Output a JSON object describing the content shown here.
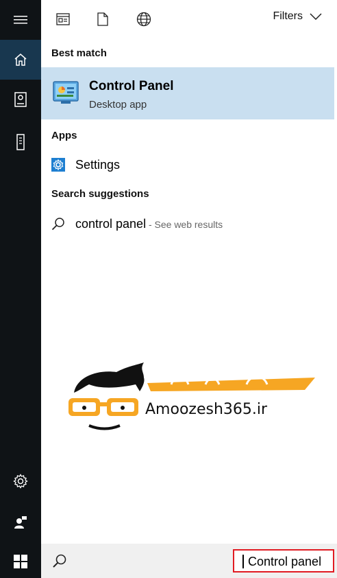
{
  "toolbar": {
    "filters_label": "Filters"
  },
  "results": {
    "best_match_heading": "Best match",
    "best_match": {
      "title": "Control Panel",
      "subtitle": "Desktop app"
    },
    "apps_heading": "Apps",
    "apps": [
      {
        "label": "Settings"
      }
    ],
    "suggestions_heading": "Search suggestions",
    "suggestions": [
      {
        "label": "control panel",
        "suffix": " - See web results"
      }
    ]
  },
  "watermark": {
    "text": "Amoozesh365.ir",
    "persian_text": "آموزش ۳۶۵"
  },
  "search": {
    "value": "Control panel"
  },
  "colors": {
    "rail": "#0f1316",
    "rail_active": "#18374f",
    "best_match_bg": "#c9dff0",
    "highlight": "#e11b22",
    "watermark_orange": "#f6a623"
  }
}
